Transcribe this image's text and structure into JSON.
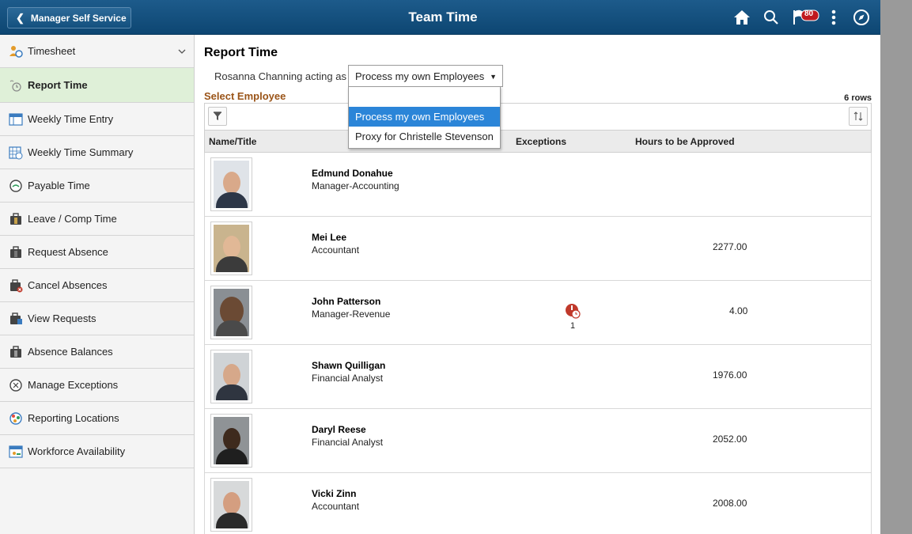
{
  "header": {
    "back_label": "Manager Self Service",
    "title": "Team Time",
    "notification_count": "80",
    "icons": [
      "home-icon",
      "search-icon",
      "notification-flag-icon",
      "more-actions-icon",
      "navbar-compass-icon"
    ]
  },
  "sidebar": {
    "items": [
      {
        "label": "Timesheet",
        "icon": "timesheet-icon"
      },
      {
        "label": "Report Time",
        "icon": "report-time-icon"
      },
      {
        "label": "Weekly Time Entry",
        "icon": "weekly-entry-icon"
      },
      {
        "label": "Weekly Time Summary",
        "icon": "weekly-summary-icon"
      },
      {
        "label": "Payable Time",
        "icon": "payable-time-icon"
      },
      {
        "label": "Leave / Comp Time",
        "icon": "leave-icon"
      },
      {
        "label": "Request Absence",
        "icon": "request-absence-icon"
      },
      {
        "label": "Cancel Absences",
        "icon": "cancel-absence-icon"
      },
      {
        "label": "View Requests",
        "icon": "view-requests-icon"
      },
      {
        "label": "Absence Balances",
        "icon": "absence-balances-icon"
      },
      {
        "label": "Manage Exceptions",
        "icon": "manage-exceptions-icon"
      },
      {
        "label": "Reporting Locations",
        "icon": "reporting-locations-icon"
      },
      {
        "label": "Workforce Availability",
        "icon": "workforce-availability-icon"
      }
    ]
  },
  "main": {
    "page_title": "Report Time",
    "acting_label": "Rosanna Channing acting as",
    "acting_value": "Process my own Employees",
    "acting_options": [
      "",
      "Process my own Employees",
      "Proxy for Christelle Stevenson"
    ],
    "section_title": "Select Employee",
    "rows_count": "6 rows",
    "columns": {
      "name": "Name/Title",
      "exceptions": "Exceptions",
      "hours": "Hours to be Approved"
    },
    "employees": [
      {
        "name": "Edmund Donahue",
        "title": "Manager-Accounting",
        "exceptions": "",
        "hours": ""
      },
      {
        "name": "Mei Lee",
        "title": "Accountant",
        "exceptions": "",
        "hours": "2277.00"
      },
      {
        "name": "John Patterson",
        "title": "Manager-Revenue",
        "exceptions": "1",
        "hours": "4.00"
      },
      {
        "name": "Shawn Quilligan",
        "title": "Financial Analyst",
        "exceptions": "",
        "hours": "1976.00"
      },
      {
        "name": "Daryl Reese",
        "title": "Financial Analyst",
        "exceptions": "",
        "hours": "2052.00"
      },
      {
        "name": "Vicki Zinn",
        "title": "Accountant",
        "exceptions": "",
        "hours": "2008.00"
      }
    ]
  },
  "colors": {
    "header": "#14507e",
    "active_item": "#dff0d8",
    "section_title": "#9a5418",
    "dropdown_selected": "#2b85d8",
    "exception": "#c0392b"
  }
}
